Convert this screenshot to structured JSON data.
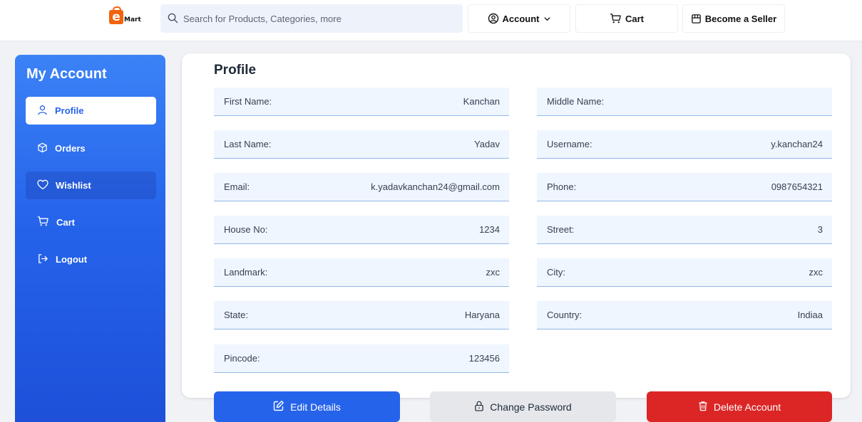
{
  "header": {
    "logo_letter": "e",
    "logo_text": "Mart",
    "search_placeholder": "Search for Products, Categories, more",
    "account_label": "Account",
    "cart_label": "Cart",
    "seller_label": "Become a Seller"
  },
  "sidebar": {
    "title": "My Account",
    "items": [
      {
        "label": "Profile",
        "icon": "user-icon"
      },
      {
        "label": "Orders",
        "icon": "package-icon"
      },
      {
        "label": "Wishlist",
        "icon": "heart-icon"
      },
      {
        "label": "Cart",
        "icon": "cart-icon"
      },
      {
        "label": "Logout",
        "icon": "logout-icon"
      }
    ]
  },
  "profile": {
    "title": "Profile",
    "fields": [
      {
        "label": "First Name:",
        "value": "Kanchan"
      },
      {
        "label": "Middle Name:",
        "value": ""
      },
      {
        "label": "Last Name:",
        "value": "Yadav"
      },
      {
        "label": "Username:",
        "value": "y.kanchan24"
      },
      {
        "label": "Email:",
        "value": "k.yadavkanchan24@gmail.com"
      },
      {
        "label": "Phone:",
        "value": "0987654321"
      },
      {
        "label": "House No:",
        "value": "1234"
      },
      {
        "label": "Street:",
        "value": "3"
      },
      {
        "label": "Landmark:",
        "value": "zxc"
      },
      {
        "label": "City:",
        "value": "zxc"
      },
      {
        "label": "State:",
        "value": "Haryana"
      },
      {
        "label": "Country:",
        "value": "Indiaa"
      },
      {
        "label": "Pincode:",
        "value": "123456"
      }
    ]
  },
  "actions": {
    "edit": "Edit Details",
    "change_password": "Change Password",
    "delete": "Delete Account"
  },
  "colors": {
    "primary": "#2563eb",
    "danger": "#dc2626",
    "brand": "#f2630d"
  }
}
